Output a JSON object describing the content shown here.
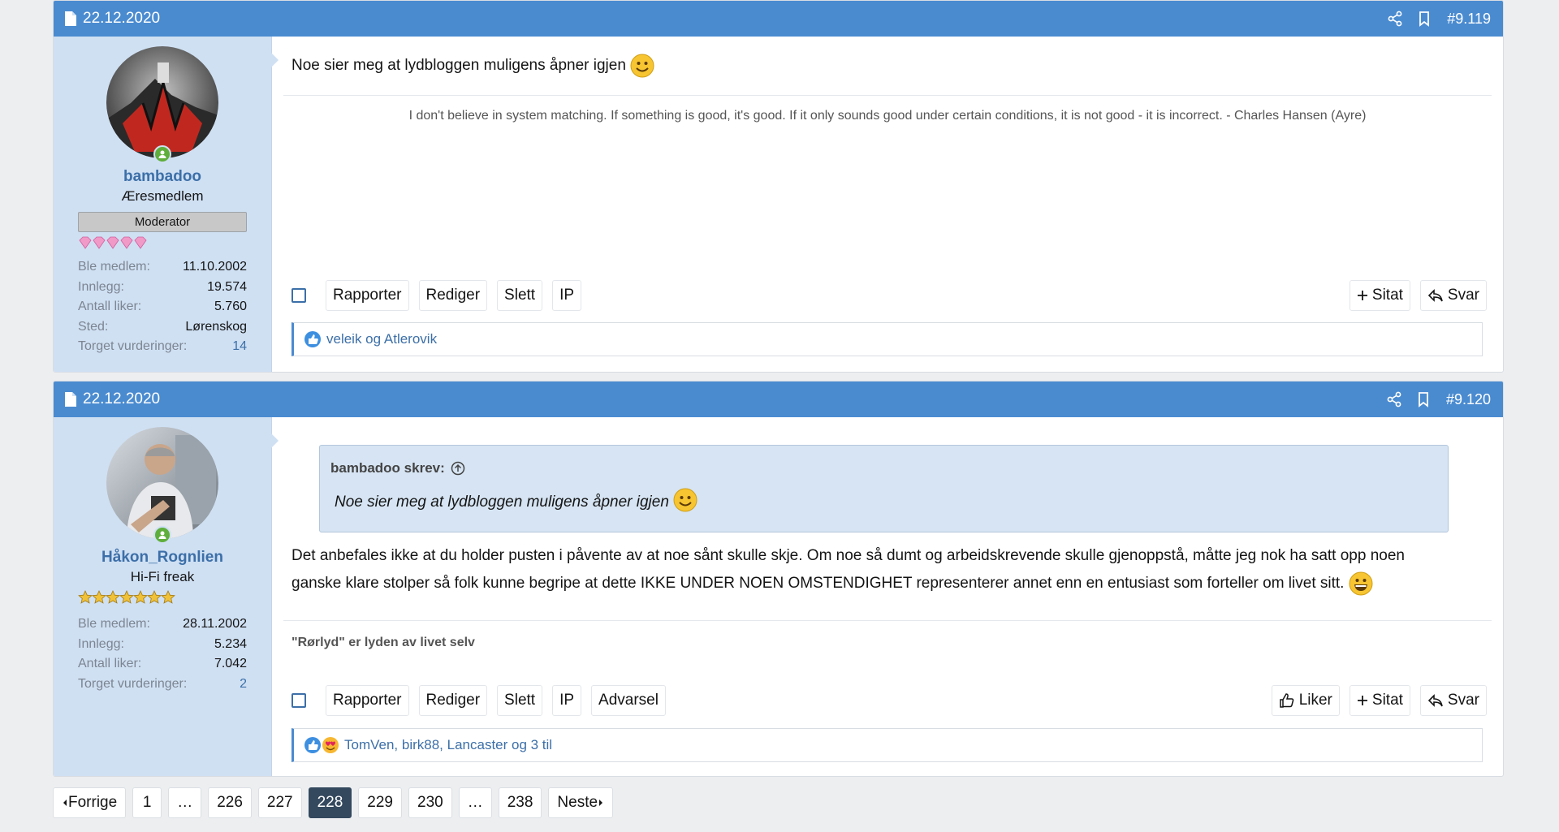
{
  "posts": [
    {
      "date": "22.12.2020",
      "number": "#9.119",
      "user": {
        "name": "bambadoo",
        "title": "Æresmedlem",
        "banner": "Moderator",
        "rating_icons": "diamonds",
        "stats": [
          {
            "k": "Ble medlem:",
            "v": "11.10.2002"
          },
          {
            "k": "Innlegg:",
            "v": "19.574"
          },
          {
            "k": "Antall liker:",
            "v": "5.760"
          },
          {
            "k": "Sted:",
            "v": "Lørenskog"
          },
          {
            "k": "Torget vurderinger:",
            "v": "14"
          }
        ]
      },
      "message": "Noe sier meg at lydbloggen muligens åpner igjen",
      "signature": "I don't believe in system matching. If something is good, it's good. If it only sounds good under certain conditions, it is not good - it is incorrect. - Charles Hansen (Ayre)",
      "actions": [
        "Rapporter",
        "Rediger",
        "Slett",
        "IP"
      ],
      "right_actions": [
        "Sitat",
        "Svar"
      ],
      "reactions": "veleik og Atlerovik"
    },
    {
      "date": "22.12.2020",
      "number": "#9.120",
      "user": {
        "name": "Håkon_Rognlien",
        "title": "Hi-Fi freak",
        "rating_icons": "stars",
        "stats": [
          {
            "k": "Ble medlem:",
            "v": "28.11.2002"
          },
          {
            "k": "Innlegg:",
            "v": "5.234"
          },
          {
            "k": "Antall liker:",
            "v": "7.042"
          },
          {
            "k": "Torget vurderinger:",
            "v": "2"
          }
        ]
      },
      "quote": {
        "author": "bambadoo skrev:",
        "text": "Noe sier meg at lydbloggen muligens åpner igjen"
      },
      "message_line1": "Det anbefales ikke at du holder pusten i påvente av at noe sånt skulle skje. Om noe så dumt og arbeidskrevende skulle gjenoppstå, måtte jeg nok ha satt opp noen",
      "message_line2": "ganske klare stolper så folk kunne begripe at dette IKKE UNDER NOEN OMSTENDIGHET representerer annet enn en entusiast som forteller om livet sitt.",
      "signature": "\"Rørlyd\" er lyden av livet selv",
      "actions": [
        "Rapporter",
        "Rediger",
        "Slett",
        "IP",
        "Advarsel"
      ],
      "right_actions": [
        "Liker",
        "Sitat",
        "Svar"
      ],
      "reactions": "TomVen, birk88, Lancaster og 3 til"
    }
  ],
  "pagination": {
    "prev": "Forrige",
    "next": "Neste",
    "pages": [
      "1",
      "…",
      "226",
      "227",
      "228",
      "229",
      "230",
      "…",
      "238"
    ],
    "current": "228"
  },
  "colors": {
    "header": "#4a8bd0",
    "user_cell": "#cfe0f3",
    "link": "#3c6fa8",
    "active_page": "#34495e"
  }
}
